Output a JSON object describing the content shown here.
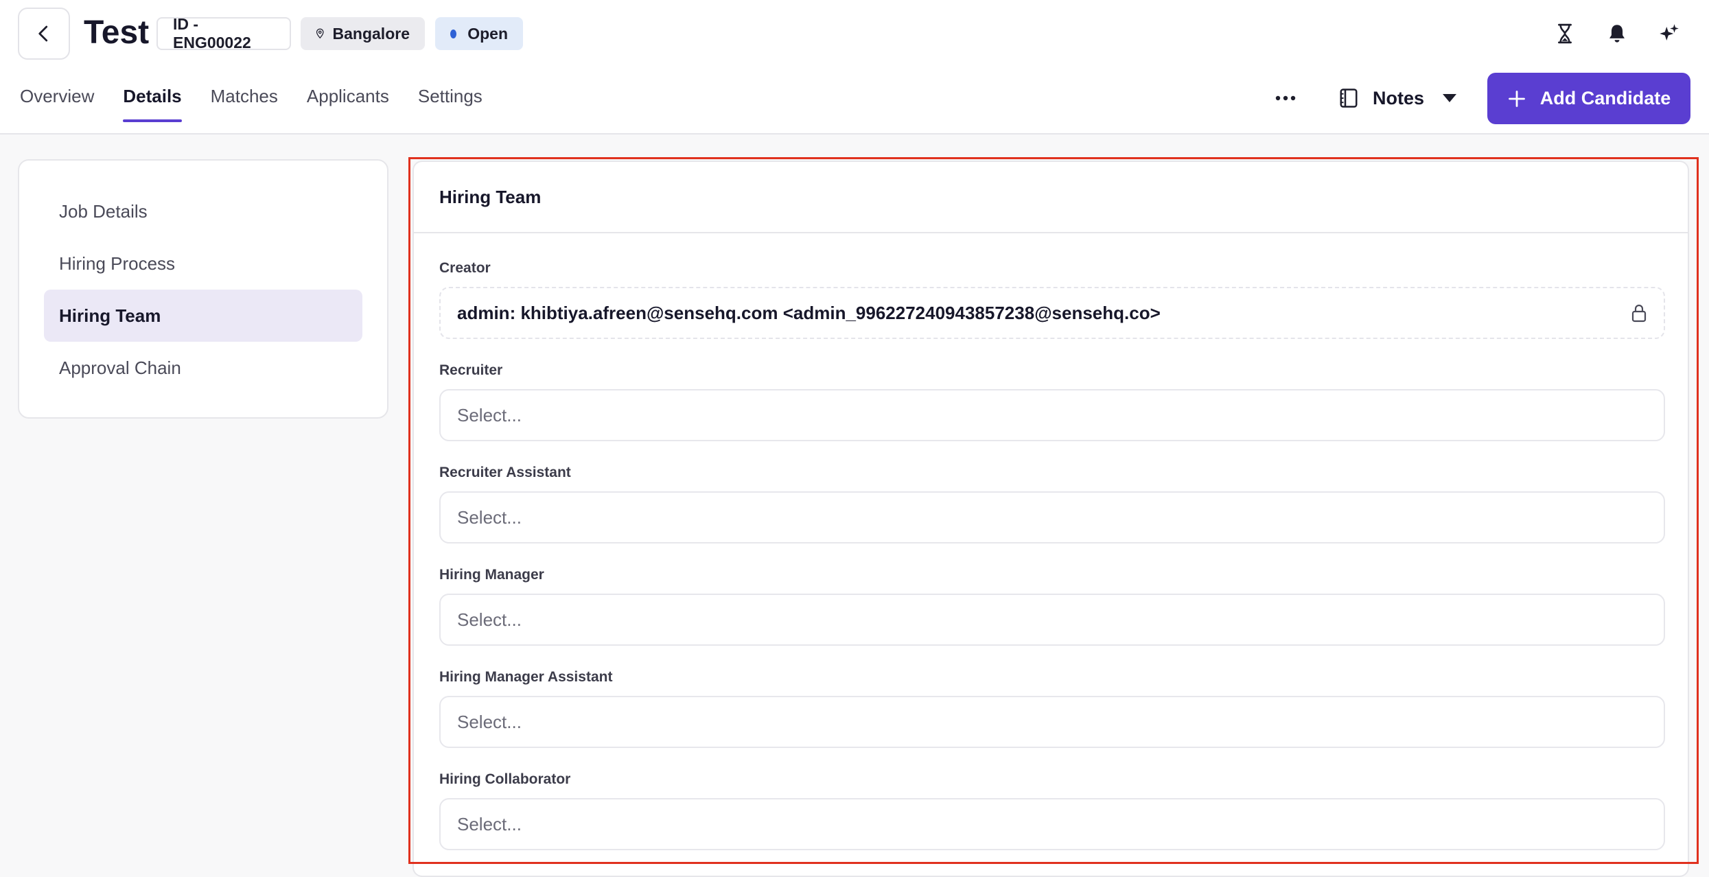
{
  "header": {
    "title": "Test",
    "job_id": "ID - ENG00022",
    "location": "Bangalore",
    "status": "Open",
    "status_color": "#2f62d6"
  },
  "tabs": [
    "Overview",
    "Details",
    "Matches",
    "Applicants",
    "Settings"
  ],
  "active_tab": "Details",
  "toolbar": {
    "notes_label": "Notes",
    "add_candidate_label": "Add Candidate",
    "accent_color": "#5a3ed1"
  },
  "sidenav": {
    "items": [
      "Job Details",
      "Hiring Process",
      "Hiring Team",
      "Approval Chain"
    ],
    "active": "Hiring Team"
  },
  "panel": {
    "title": "Hiring Team",
    "fields": [
      {
        "label": "Creator",
        "value": "admin: khibtiya.afreen@sensehq.com <admin_996227240943857238@sensehq.co>",
        "locked": true
      },
      {
        "label": "Recruiter",
        "placeholder": "Select..."
      },
      {
        "label": "Recruiter Assistant",
        "placeholder": "Select..."
      },
      {
        "label": "Hiring Manager",
        "placeholder": "Select..."
      },
      {
        "label": "Hiring Manager Assistant",
        "placeholder": "Select..."
      },
      {
        "label": "Hiring Collaborator",
        "placeholder": "Select..."
      }
    ]
  }
}
